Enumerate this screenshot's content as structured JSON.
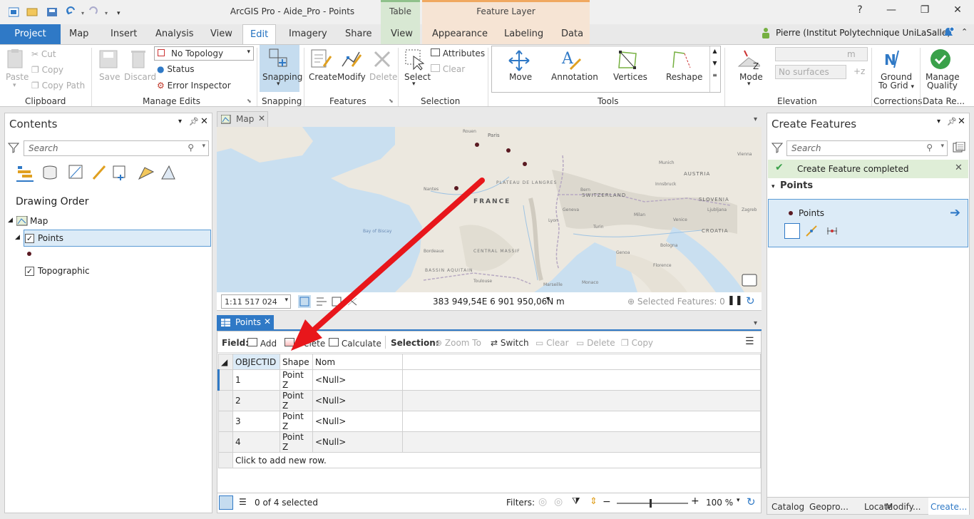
{
  "app": {
    "title": "ArcGIS Pro - Aide_Pro - Points"
  },
  "context_tabs": {
    "table": "Table",
    "feature_layer": "Feature Layer"
  },
  "window": {
    "help": "?",
    "minimize": "—",
    "restore": "❐",
    "close": "✕"
  },
  "tabs": [
    "Project",
    "Map",
    "Insert",
    "Analysis",
    "View",
    "Edit",
    "Imagery",
    "Share",
    "View",
    "Appearance",
    "Labeling",
    "Data"
  ],
  "user": {
    "name": "Pierre (Institut Polytechnique UniLaSalle)"
  },
  "ribbon": {
    "clipboard": {
      "paste": "Paste",
      "cut": "Cut",
      "copy": "Copy",
      "copy_path": "Copy Path",
      "label": "Clipboard"
    },
    "manage_edits": {
      "save": "Save",
      "discard": "Discard",
      "topology": "No Topology",
      "status": "Status",
      "error_inspector": "Error Inspector",
      "label": "Manage Edits"
    },
    "snapping": {
      "snapping": "Snapping",
      "label": "Snapping"
    },
    "features": {
      "create": "Create",
      "modify": "Modify",
      "delete": "Delete",
      "label": "Features"
    },
    "selection": {
      "select": "Select",
      "attributes": "Attributes",
      "clear": "Clear",
      "label": "Selection"
    },
    "tools": {
      "move": "Move",
      "annotation": "Annotation",
      "vertices": "Vertices",
      "reshape": "Reshape",
      "label": "Tools"
    },
    "elevation": {
      "mode": "Mode",
      "units": "m",
      "surfaces": "No surfaces",
      "label": "Elevation"
    },
    "corrections": {
      "ground_to_grid": "Ground",
      "ground_to_grid2": "To Grid",
      "label": "Corrections"
    },
    "data_reviewer": {
      "manage": "Manage",
      "quality": "Quality",
      "label": "Data Re..."
    }
  },
  "contents": {
    "title": "Contents",
    "search_placeholder": "Search",
    "drawing_order": "Drawing Order",
    "layers": {
      "map": "Map",
      "points": "Points",
      "topographic": "Topographic"
    }
  },
  "map": {
    "tab": "Map",
    "scale": "1:11 517 024",
    "coords": "383 949,54E 6 901 950,06N m",
    "selected_features": "Selected Features: 0",
    "places": {
      "france": "FRANCE",
      "paris": "Paris",
      "plateau": "PLATEAU DE LANGRES",
      "switzerland": "SWITZERLAND",
      "austria": "AUSTRIA",
      "slovenia": "SLOVENIA",
      "croatia": "CROATIA",
      "bay": "Bay of Biscay",
      "massif": "CENTRAL MASSIF",
      "bassin": "BASSIN AQUITAIN",
      "nantes": "Nantes",
      "rouen": "Rouen",
      "milan": "Milan",
      "turin": "Turin",
      "lyon": "Lyon",
      "geneva": "Geneva",
      "bern": "Bern",
      "zagreb": "Zagreb",
      "venice": "Venice",
      "bordeaux": "Bordeaux",
      "toulouse": "Toulouse",
      "marseille": "Marseille",
      "monaco": "Monaco",
      "genoa": "Genoa",
      "florence": "Florence",
      "bologna": "Bologna",
      "munich": "Munich",
      "vienna": "Vienna",
      "ljubljana": "Ljubljana",
      "innsbruck": "Innsbruck"
    }
  },
  "table_view": {
    "tab": "Points",
    "field_label": "Field:",
    "add": "Add",
    "delete": "Delete",
    "calculate": "Calculate",
    "selection_label": "Selection:",
    "zoom_to": "Zoom To",
    "switch": "Switch",
    "clear": "Clear",
    "delete2": "Delete",
    "copy": "Copy",
    "columns": [
      "OBJECTID",
      "Shape",
      "Nom"
    ],
    "rows": [
      [
        "1",
        "Point Z",
        "<Null>"
      ],
      [
        "2",
        "Point Z",
        "<Null>"
      ],
      [
        "3",
        "Point Z",
        "<Null>"
      ],
      [
        "4",
        "Point Z",
        "<Null>"
      ]
    ],
    "add_row": "Click to add new row.",
    "selected_count": "0 of 4 selected",
    "filters": "Filters:",
    "zoom_pct": "100 %"
  },
  "create_features": {
    "title": "Create Features",
    "search_placeholder": "Search",
    "notice": "Create Feature completed",
    "group": "Points",
    "template": "Points"
  },
  "bottom_tabs": [
    "Catalog",
    "Geopro...",
    "Locate",
    "Modify...",
    "Create..."
  ],
  "colors": {
    "accent": "#2f79c6",
    "arrow": "#e8161b",
    "point": "#5a1a22"
  }
}
